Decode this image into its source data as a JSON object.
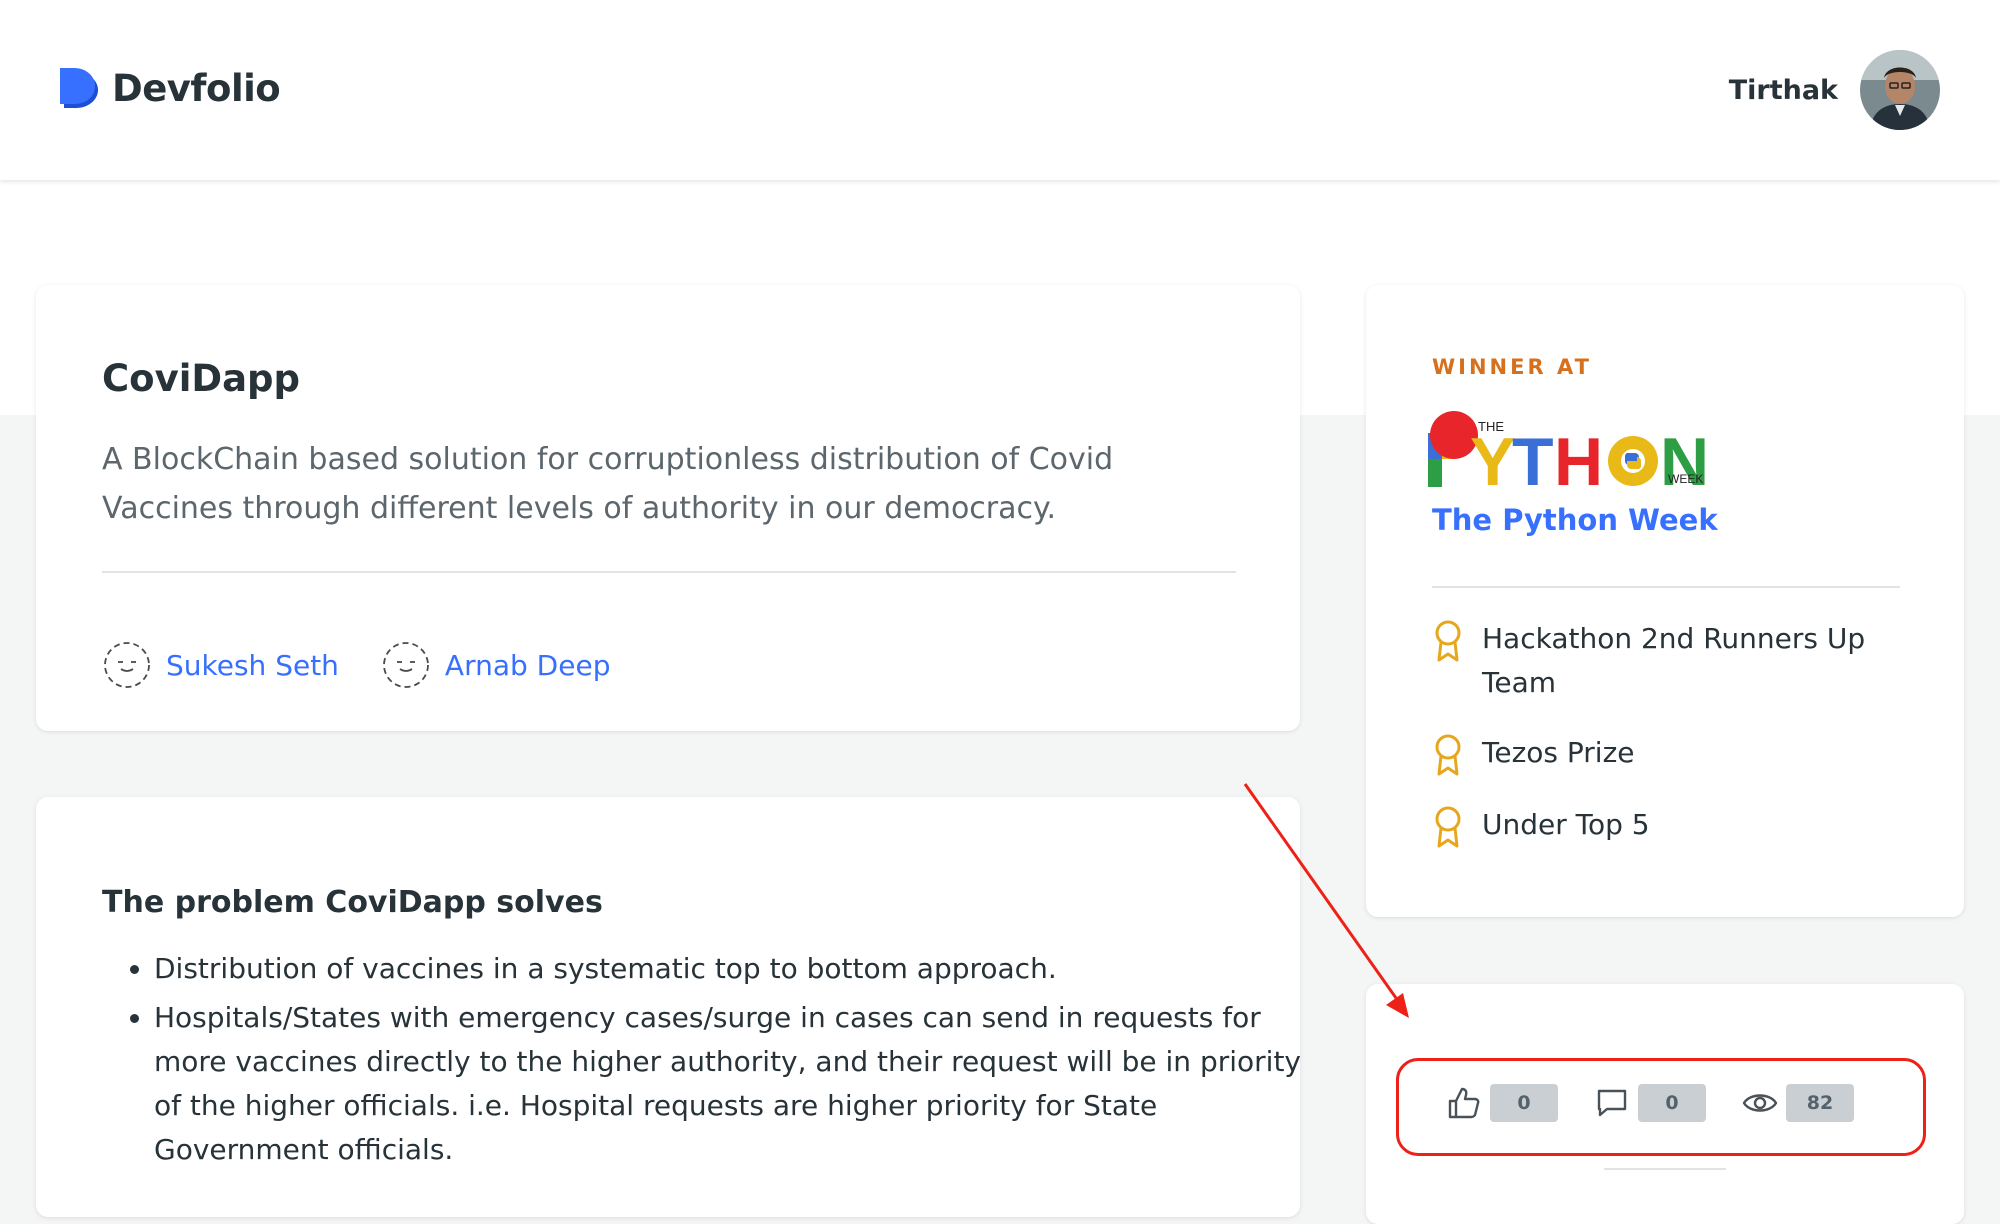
{
  "header": {
    "logo_text": "Devfolio",
    "user_name": "Tirthak"
  },
  "project": {
    "title": "CoviDapp",
    "description": "A BlockChain based solution for corruptionless distribution of Covid Vaccines through different levels of authority in our democracy.",
    "members": [
      {
        "name": "Sukesh Seth"
      },
      {
        "name": "Arnab Deep"
      }
    ]
  },
  "problem": {
    "heading": "The problem CoviDapp solves",
    "points": [
      "Distribution of vaccines in a systematic top to bottom approach.",
      "Hospitals/States with emergency cases/surge in cases can send in requests for more vaccines directly to the higher authority, and their request will be in priority of the higher officials. i.e. Hospital requests are higher priority for State Government officials."
    ]
  },
  "hackathon": {
    "label": "WINNER AT",
    "logo_main": "PYTHON",
    "logo_the": "THE",
    "logo_week": "WEEK",
    "name": "The Python Week",
    "prizes": [
      "Hackathon 2nd Runners Up Team",
      "Tezos Prize",
      "Under Top 5"
    ]
  },
  "stats": {
    "likes": "0",
    "comments": "0",
    "views": "82"
  },
  "colors": {
    "accent_blue": "#3770ff",
    "winner_orange": "#d7701c",
    "prize_gold": "#e7a71d",
    "annotation_red": "#ee2118"
  }
}
